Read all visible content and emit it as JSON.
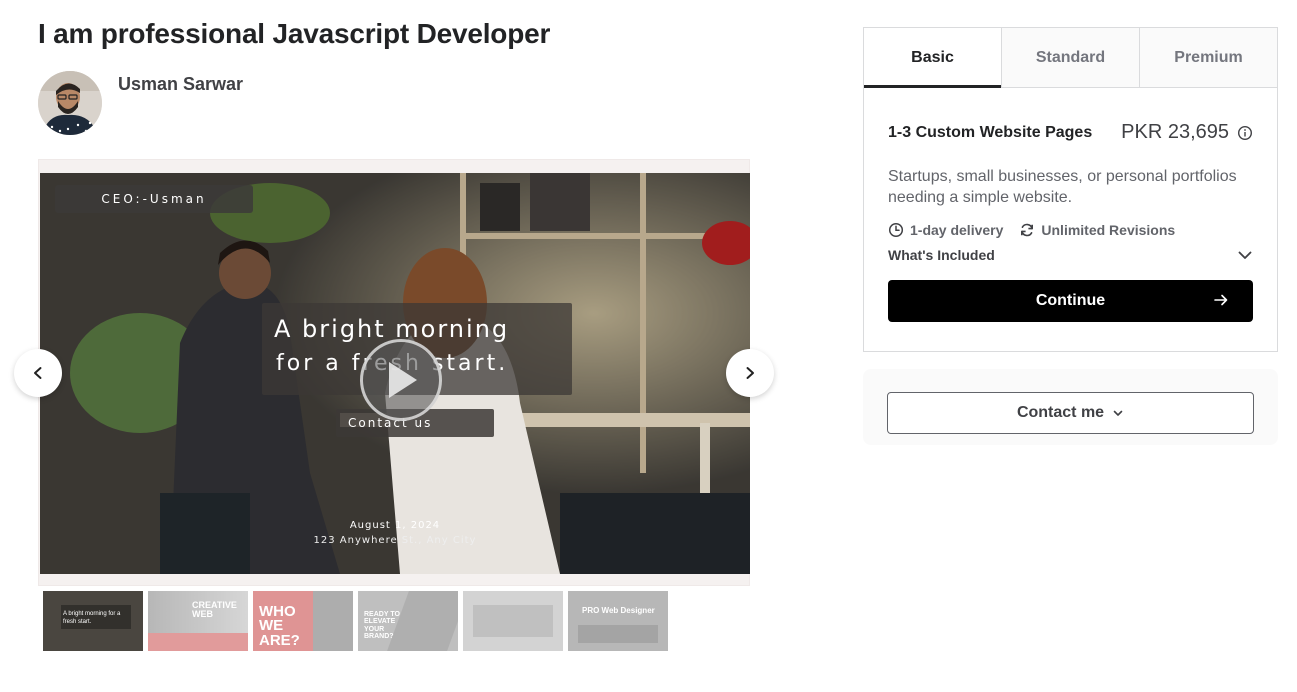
{
  "gig": {
    "title": "I am professional Javascript Developer"
  },
  "seller": {
    "name": "Usman Sarwar"
  },
  "gallery": {
    "slide": {
      "badge": "CEO:-Usman",
      "headline_line1": "A bright morning",
      "headline_line2": "for a fresh start.",
      "cta": "Contact us",
      "date": "August 1, 2024",
      "address": "123 Anywhere St., Any City"
    },
    "thumbnails": [
      {
        "text": "A bright morning for a fresh start."
      },
      {
        "text": "CREATIVE WEB"
      },
      {
        "text": "WHO WE ARE?"
      },
      {
        "text": "READY TO ELEVATE YOUR BRAND?"
      },
      {
        "text": ""
      },
      {
        "text": "PRO Web Designer"
      }
    ]
  },
  "package": {
    "tabs": [
      {
        "label": "Basic"
      },
      {
        "label": "Standard"
      },
      {
        "label": "Premium"
      }
    ],
    "name": "1-3 Custom Website Pages",
    "price": "PKR 23,695",
    "description": "Startups, small businesses, or personal portfolios needing a simple website.",
    "delivery": "1-day delivery",
    "revisions": "Unlimited Revisions",
    "included_label": "What's Included",
    "continue_label": "Continue"
  },
  "contact": {
    "label": "Contact me"
  },
  "colors": {
    "primary_button": "#000000",
    "text_dark": "#222325",
    "text_muted": "#62646a",
    "border": "#dadbdd"
  }
}
